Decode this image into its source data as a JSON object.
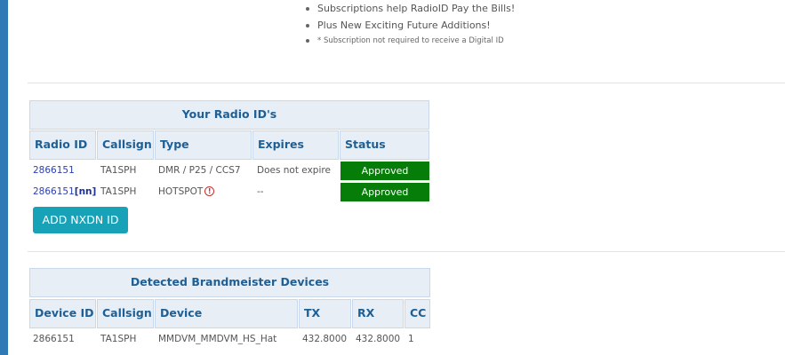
{
  "info": {
    "bullets": [
      "Subscriptions help RadioID Pay the Bills!",
      "Plus New Exciting Future Additions!"
    ],
    "note": "* Subscription not required to receive a Digital ID"
  },
  "radio_ids": {
    "title": "Your Radio ID's",
    "columns": [
      "Radio ID",
      "Callsign",
      "Type",
      "Expires",
      "Status"
    ],
    "rows": [
      {
        "radio_id": "2866151",
        "suffix": "",
        "callsign": "TA1SPH",
        "type": "DMR / P25 / CCS7",
        "expires": "Does not expire",
        "status": "Approved"
      },
      {
        "radio_id": "2866151",
        "suffix": "[nn]",
        "callsign": "TA1SPH",
        "type": "HOTSPOT",
        "expires": "--",
        "status": "Approved"
      }
    ],
    "add_button": "ADD NXDN ID"
  },
  "devices": {
    "title": "Detected Brandmeister Devices",
    "columns": [
      "Device ID",
      "Callsign",
      "Device",
      "TX",
      "RX",
      "CC"
    ],
    "rows": [
      {
        "device_id": "2866151",
        "callsign": "TA1SPH",
        "device": "MMDVM_MMDVM_HS_Hat",
        "tx": "432.8000",
        "rx": "432.8000",
        "cc": "1"
      }
    ]
  },
  "colors": {
    "approved": "#077d09",
    "header_text": "#1e5f95",
    "header_bg": "#e8eef5",
    "button": "#17a2b8",
    "link": "#2a3fb5"
  }
}
